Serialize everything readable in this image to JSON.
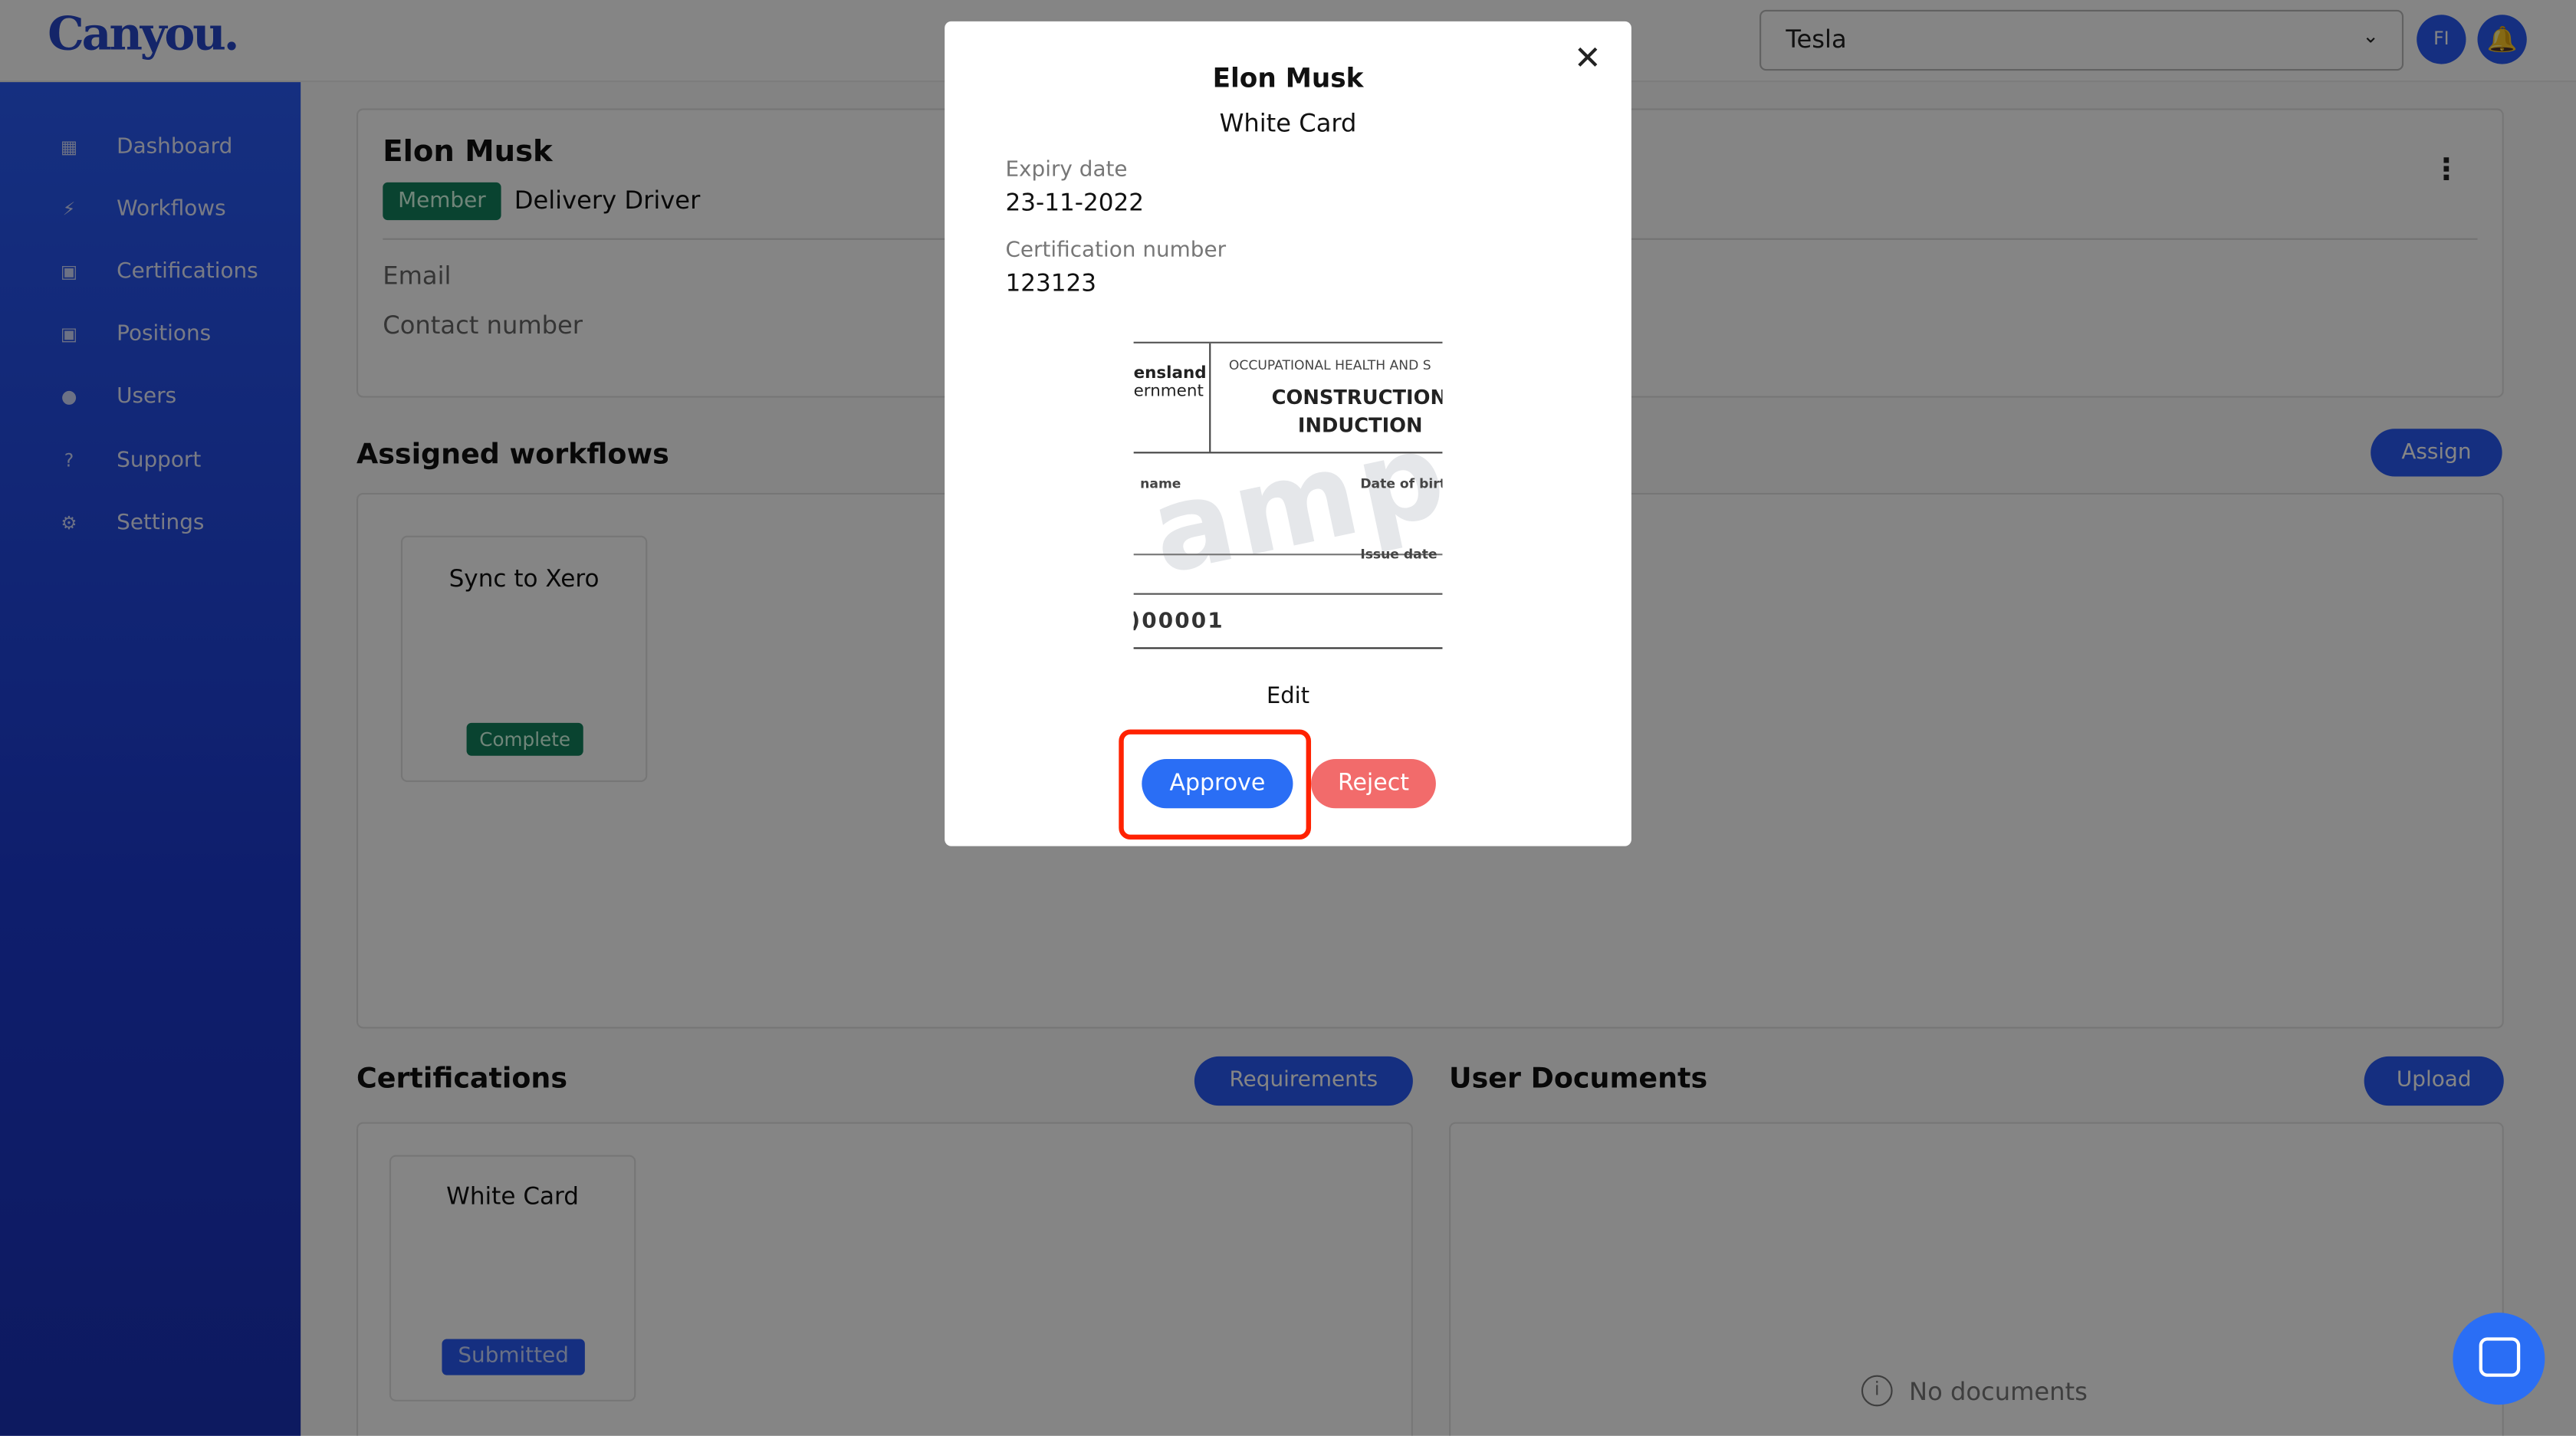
{
  "app": {
    "logo": "Canyou.",
    "org_select": "Tesla",
    "avatar_initials": "FI"
  },
  "sidebar": {
    "items": [
      {
        "label": "Dashboard",
        "icon": "dashboard-icon"
      },
      {
        "label": "Workflows",
        "icon": "bolt-icon"
      },
      {
        "label": "Certifications",
        "icon": "briefcase-icon"
      },
      {
        "label": "Positions",
        "icon": "briefcase-icon"
      },
      {
        "label": "Users",
        "icon": "user-icon"
      },
      {
        "label": "Support",
        "icon": "support-icon"
      },
      {
        "label": "Settings",
        "icon": "gear-icon"
      }
    ]
  },
  "profile": {
    "name": "Elon Musk",
    "role_badge": "Member",
    "position": "Delivery Driver",
    "email_label": "Email",
    "contact_label": "Contact number"
  },
  "workflows": {
    "title": "Assigned workflows",
    "assign_label": "Assign",
    "items": [
      {
        "name": "Sync to Xero",
        "status": "Complete"
      }
    ]
  },
  "certifications": {
    "title": "Certifications",
    "requirements_label": "Requirements",
    "items": [
      {
        "name": "White Card",
        "status": "Submitted"
      }
    ]
  },
  "documents": {
    "title": "User Documents",
    "upload_label": "Upload",
    "empty": "No documents"
  },
  "modal": {
    "name": "Elon Musk",
    "cert": "White Card",
    "expiry_label": "Expiry date",
    "expiry_value": "23-11-2022",
    "number_label": "Certification number",
    "number_value": "123123",
    "image": {
      "gov": [
        "ensland",
        "ernment"
      ],
      "header": "OCCUPATIONAL HEALTH AND S",
      "title1": "CONSTRUCTION",
      "title2": "INDUCTION",
      "name_label": "name",
      "dob_label": "Date of birth",
      "issue_label": "Issue date",
      "card_no": ")00001",
      "watermark": "ampl"
    },
    "edit_label": "Edit",
    "approve_label": "Approve",
    "reject_label": "Reject"
  },
  "colors": {
    "primary": "#2a5bf5",
    "success": "#12805c",
    "danger": "#f26b6b",
    "highlight": "#ff2200"
  }
}
